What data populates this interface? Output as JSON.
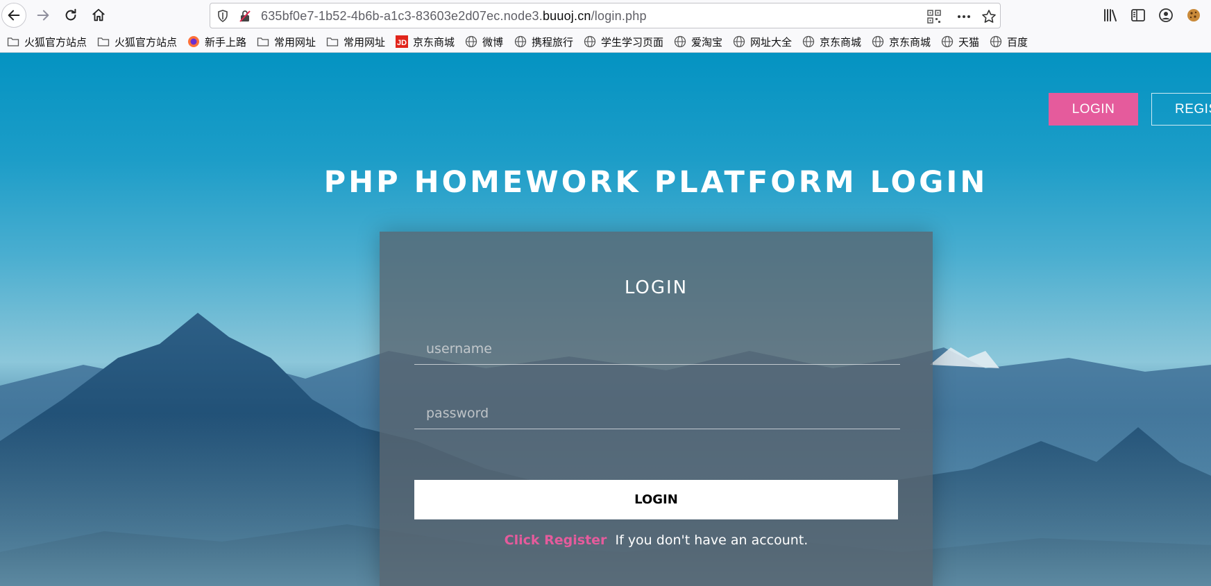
{
  "browser": {
    "url_prefix": "635bf0e7-1b52-4b6b-a1c3-83603e2d07ec.node3.",
    "url_domain": "buuoj.cn",
    "url_path": "/login.php"
  },
  "bookmarks": [
    {
      "label": "火狐官方站点",
      "icon": "folder-icon"
    },
    {
      "label": "火狐官方站点",
      "icon": "folder-icon"
    },
    {
      "label": "新手上路",
      "icon": "firefox-icon"
    },
    {
      "label": "常用网址",
      "icon": "folder-icon"
    },
    {
      "label": "常用网址",
      "icon": "folder-icon"
    },
    {
      "label": "京东商城",
      "icon": "jd-icon"
    },
    {
      "label": "微博",
      "icon": "globe-icon"
    },
    {
      "label": "携程旅行",
      "icon": "globe-icon"
    },
    {
      "label": "学生学习页面",
      "icon": "globe-icon"
    },
    {
      "label": "爱淘宝",
      "icon": "globe-icon"
    },
    {
      "label": "网址大全",
      "icon": "globe-icon"
    },
    {
      "label": "京东商城",
      "icon": "globe-icon"
    },
    {
      "label": "京东商城",
      "icon": "globe-icon"
    },
    {
      "label": "天猫",
      "icon": "globe-icon"
    },
    {
      "label": "百度",
      "icon": "globe-icon"
    }
  ],
  "header": {
    "login_label": "LOGIN",
    "register_label": "REGIS"
  },
  "hero": {
    "title": "PHP HOMEWORK PLATFORM LOGIN"
  },
  "form": {
    "title": "LOGIN",
    "username_placeholder": "username",
    "password_placeholder": "password",
    "submit_label": "LOGIN",
    "register_link": "Click Register",
    "register_text": "If you don't have an account."
  },
  "colors": {
    "accent": "#e55b9c",
    "sky": "#0493c2"
  }
}
